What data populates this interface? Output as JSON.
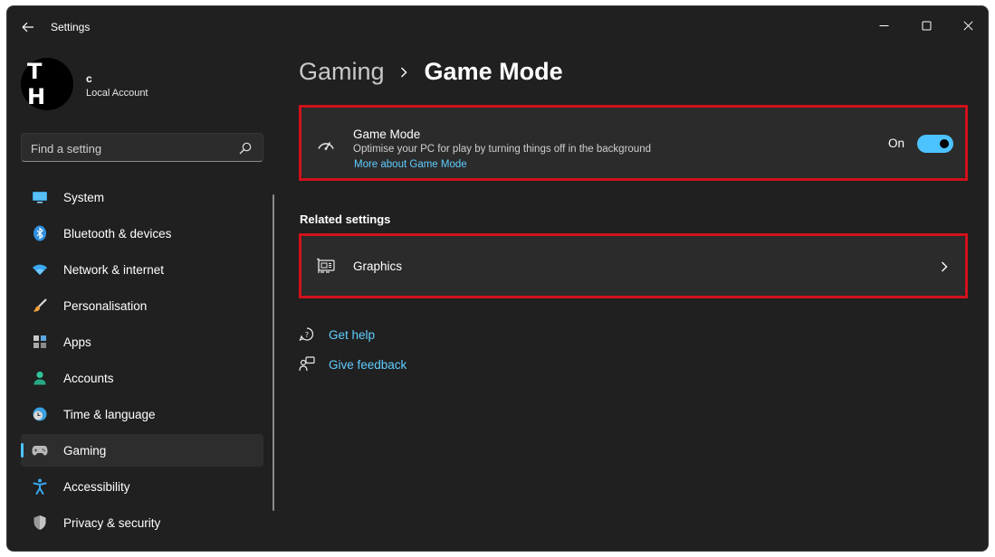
{
  "window": {
    "title": "Settings"
  },
  "profile": {
    "avatar_initials": "T H",
    "name": "c",
    "account_type": "Local Account"
  },
  "search": {
    "placeholder": "Find a setting"
  },
  "sidebar": {
    "items": [
      {
        "label": "System",
        "icon": "monitor-icon"
      },
      {
        "label": "Bluetooth & devices",
        "icon": "bluetooth-icon"
      },
      {
        "label": "Network & internet",
        "icon": "wifi-icon"
      },
      {
        "label": "Personalisation",
        "icon": "brush-icon"
      },
      {
        "label": "Apps",
        "icon": "apps-icon"
      },
      {
        "label": "Accounts",
        "icon": "person-icon"
      },
      {
        "label": "Time & language",
        "icon": "globe-clock-icon"
      },
      {
        "label": "Gaming",
        "icon": "gamepad-icon",
        "selected": true
      },
      {
        "label": "Accessibility",
        "icon": "accessibility-icon"
      },
      {
        "label": "Privacy & security",
        "icon": "shield-icon"
      }
    ]
  },
  "breadcrumb": {
    "parent": "Gaming",
    "current": "Game Mode"
  },
  "game_mode": {
    "title": "Game Mode",
    "description": "Optimise your PC for play by turning things off in the background",
    "link": "More about Game Mode",
    "state_label": "On",
    "enabled": true
  },
  "related": {
    "heading": "Related settings",
    "graphics_label": "Graphics"
  },
  "help": {
    "get_help": "Get help",
    "give_feedback": "Give feedback"
  },
  "colors": {
    "accent": "#4cc2ff",
    "link": "#60cdff",
    "highlight_border": "#d0121b",
    "background": "#202020",
    "card": "#2b2b2b"
  }
}
